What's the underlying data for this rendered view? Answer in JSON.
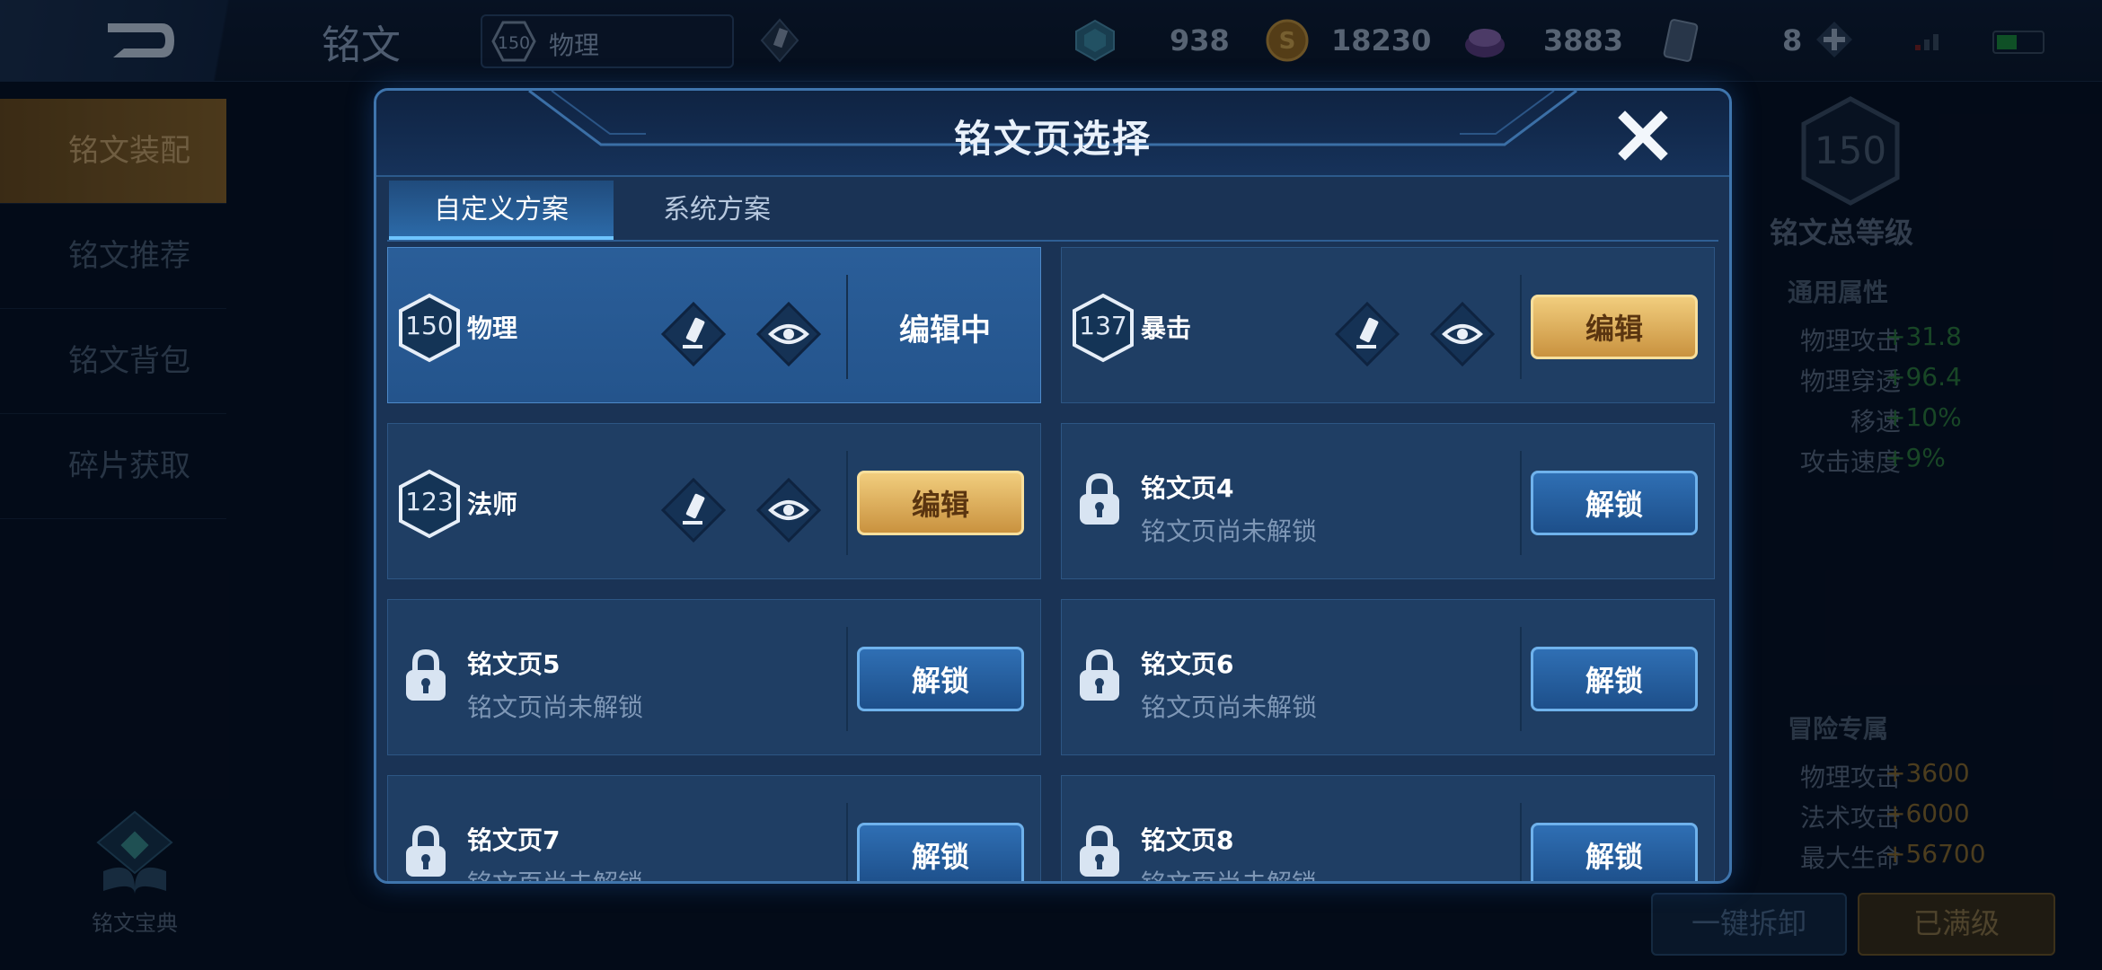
{
  "app": {
    "title": "铭文"
  },
  "topbar": {
    "level": "150",
    "page_name": "物理",
    "resources": [
      {
        "icon": "diamond-icon",
        "value": "938"
      },
      {
        "icon": "gold-coin-icon",
        "value": "18230"
      },
      {
        "icon": "crystal-icon",
        "value": "3883"
      },
      {
        "icon": "card-icon",
        "value": "8"
      }
    ]
  },
  "sidebar": {
    "items": [
      {
        "label": "铭文装配",
        "active": true
      },
      {
        "label": "铭文推荐"
      },
      {
        "label": "铭文背包"
      },
      {
        "label": "碎片获取"
      }
    ],
    "codex_label": "铭文宝典"
  },
  "right_panel": {
    "total_level": "150",
    "total_level_label": "铭文总等级",
    "general_title": "通用属性",
    "general": [
      {
        "name": "物理攻击",
        "value": "+31.8"
      },
      {
        "name": "物理穿透",
        "value": "+96.4"
      },
      {
        "name": "移速",
        "value": "+10%"
      },
      {
        "name": "攻击速度",
        "value": "+9%"
      }
    ],
    "adventure_title": "冒险专属",
    "adventure": [
      {
        "name": "物理攻击",
        "value": "+3600"
      },
      {
        "name": "法术攻击",
        "value": "+6000"
      },
      {
        "name": "最大生命",
        "value": "+56700"
      }
    ],
    "disassemble_button": "一键拆卸",
    "maxed_button": "已满级"
  },
  "modal": {
    "title": "铭文页选择",
    "tabs": [
      "自定义方案",
      "系统方案"
    ],
    "pages": [
      {
        "level": "150",
        "name": "物理",
        "status": "编辑中"
      },
      {
        "level": "137",
        "name": "暴击",
        "button": "编辑"
      },
      {
        "level": "123",
        "name": "法师",
        "button": "编辑"
      },
      {
        "name": "铭文页4",
        "subtitle": "铭文页尚未解锁",
        "button": "解锁"
      },
      {
        "name": "铭文页5",
        "subtitle": "铭文页尚未解锁",
        "button": "解锁"
      },
      {
        "name": "铭文页6",
        "subtitle": "铭文页尚未解锁",
        "button": "解锁"
      },
      {
        "name": "铭文页7",
        "subtitle": "铭文页尚未解锁",
        "button": "解锁"
      },
      {
        "name": "铭文页8",
        "subtitle": "铭文页尚未解锁",
        "button": "解锁"
      }
    ]
  },
  "colors": {
    "accent_gold": "#e2b964",
    "accent_blue": "#3f75ad",
    "positive_green": "#2d7a3a"
  }
}
